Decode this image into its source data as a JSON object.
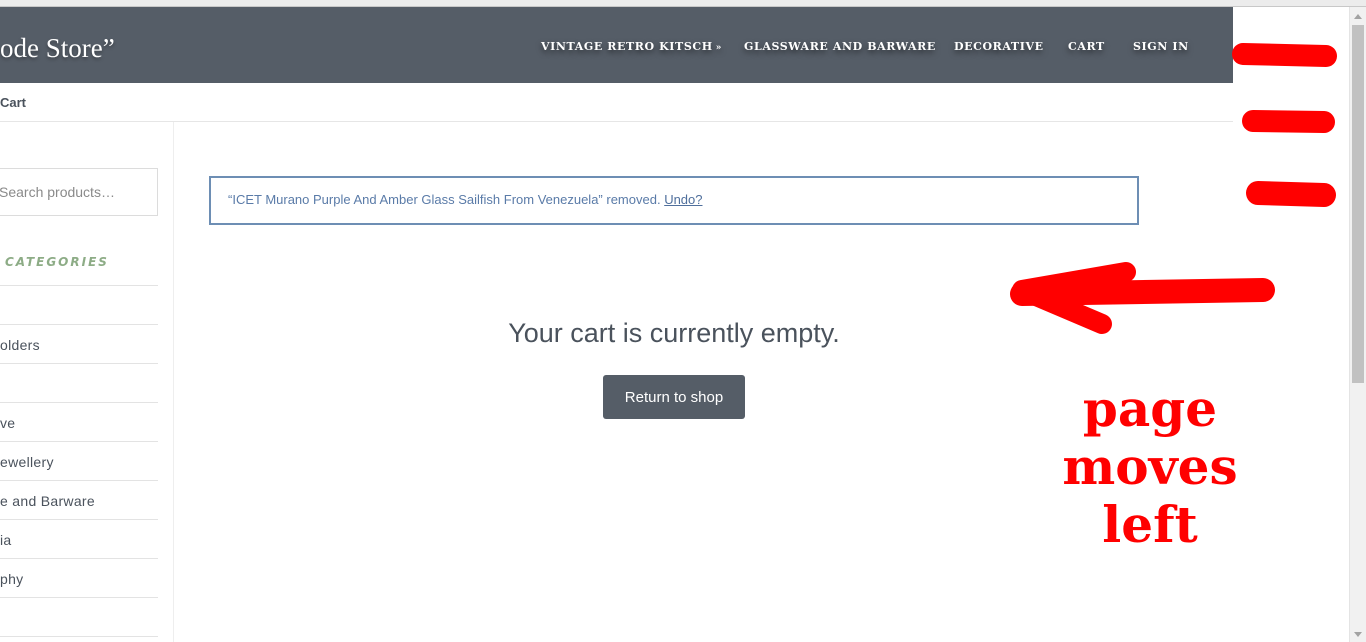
{
  "header": {
    "brand": "ode Store”",
    "nav": [
      {
        "label": "VINTAGE RETRO KITSCH",
        "dropdown_icon": "double-chevron-down-icon"
      },
      {
        "label": "GLASSWARE AND BARWARE"
      },
      {
        "label": "DECORATIVE"
      },
      {
        "label": "CART"
      },
      {
        "label": "SIGN IN"
      }
    ]
  },
  "breadcrumb": "Cart",
  "sidebar": {
    "search_placeholder": "Search products…",
    "categories_title": "CATEGORIES",
    "categories": [
      "",
      "olders",
      "",
      "ve",
      "ewellery",
      "e and Barware",
      "ia",
      "phy",
      ""
    ]
  },
  "notice": {
    "message": "“ICET Murano Purple And Amber Glass Sailfish From Venezuela” removed.",
    "undo": "Undo?"
  },
  "cart": {
    "empty_message": "Your cart is currently empty.",
    "return_button": "Return to shop"
  },
  "annotation": {
    "line1": "page moves",
    "line2": "left",
    "color": "#ff0000"
  },
  "colors": {
    "header_bg": "#555d67",
    "notice_border": "#6d8eb4",
    "category_title": "#8dac86"
  }
}
